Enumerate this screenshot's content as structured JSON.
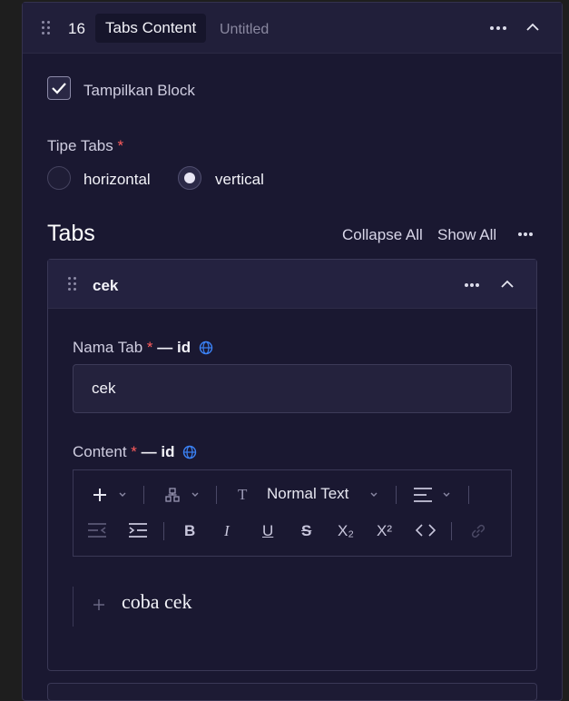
{
  "block": {
    "number": "16",
    "type_label": "Tabs Content",
    "title": "Untitled"
  },
  "show_block": {
    "label": "Tampilkan Block",
    "checked": true
  },
  "tab_type": {
    "label": "Tipe Tabs",
    "required_mark": "*",
    "options": [
      {
        "label": "horizontal",
        "selected": false
      },
      {
        "label": "vertical",
        "selected": true
      }
    ]
  },
  "tabs_section": {
    "title": "Tabs",
    "collapse_all": "Collapse All",
    "show_all": "Show All"
  },
  "tab_item": {
    "name": "cek",
    "name_field": {
      "label": "Nama Tab",
      "required_mark": "*",
      "locale": "— id",
      "value": "cek"
    },
    "content_field": {
      "label": "Content",
      "required_mark": "*",
      "locale": "— id",
      "text_style": "Normal Text",
      "toolbar_icons": [
        "plus-icon",
        "blocks-icon",
        "text-type-icon",
        "align-icon",
        "outdent-icon",
        "indent-icon",
        "bold-icon",
        "italic-icon",
        "underline-icon",
        "strikethrough-icon",
        "subscript-icon",
        "superscript-icon",
        "code-icon",
        "link-icon"
      ],
      "subscript_label": "X₂",
      "superscript_label": "X²",
      "body_text": "coba cek"
    }
  },
  "colors": {
    "panel_bg": "#1a1831",
    "header_bg": "#211f3a",
    "required": "#ff5c5c",
    "globe": "#3b82f6"
  }
}
